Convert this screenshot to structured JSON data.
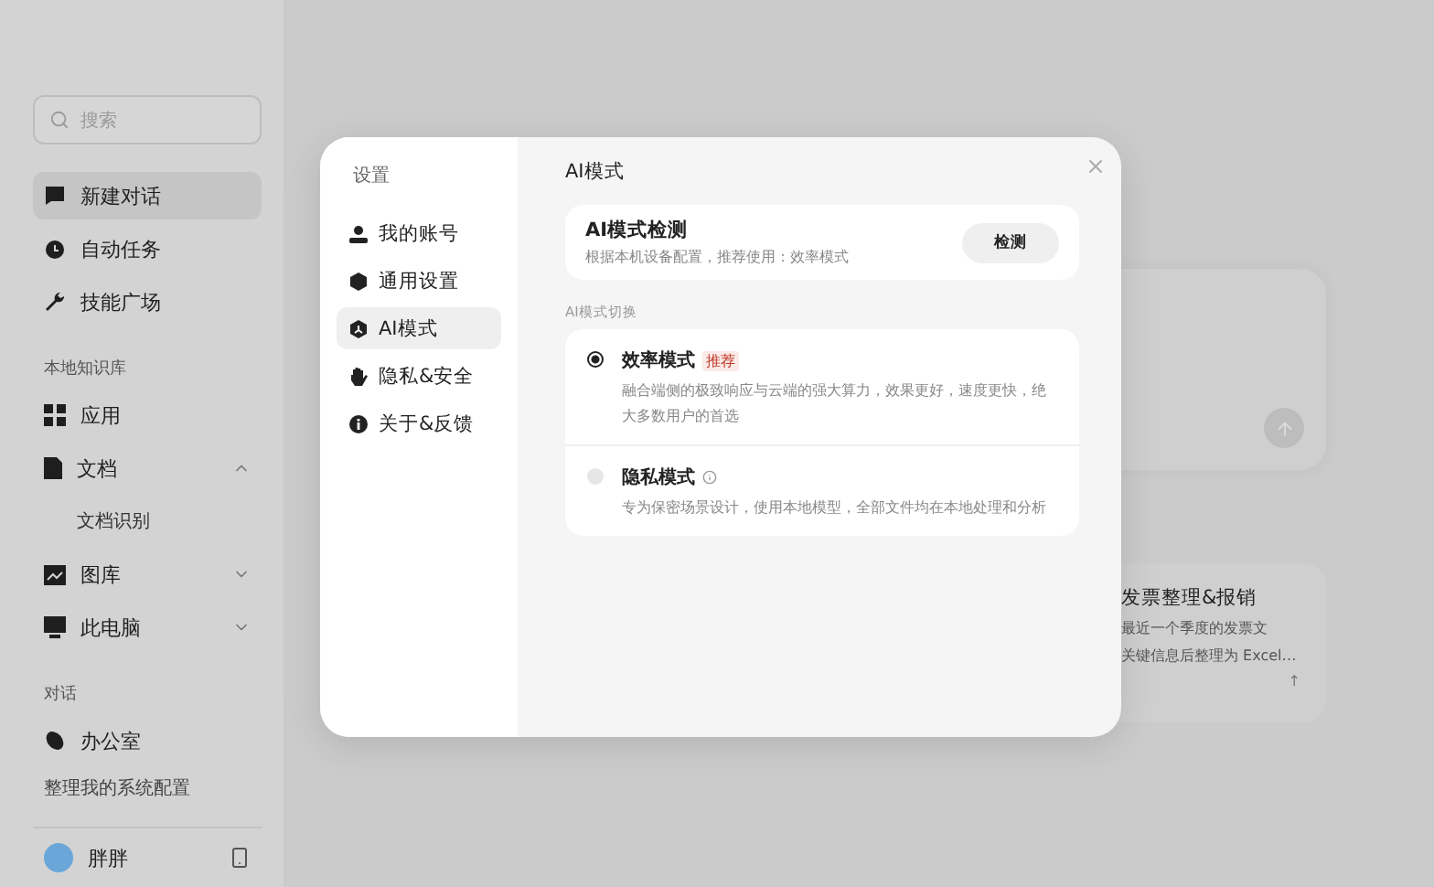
{
  "sidebar": {
    "search": {
      "placeholder": "搜索"
    },
    "items": [
      {
        "kind": "item",
        "label": "新建对话",
        "selected": true
      },
      {
        "kind": "item",
        "label": "自动任务",
        "selected": false
      },
      {
        "kind": "item",
        "label": "技能广场",
        "selected": false
      },
      {
        "kind": "section",
        "label": "本地知识库"
      },
      {
        "kind": "item",
        "label": "应用",
        "selected": false
      },
      {
        "kind": "item",
        "label": "文档",
        "selected": false,
        "expanded": true
      },
      {
        "kind": "sub",
        "label": "文档识别",
        "selected": false
      },
      {
        "kind": "item",
        "label": "图库",
        "selected": false,
        "expanded": false
      },
      {
        "kind": "item",
        "label": "此电脑",
        "selected": false,
        "expanded": false
      },
      {
        "kind": "section",
        "label": "对话"
      },
      {
        "kind": "item",
        "label": "办公室",
        "selected": false
      },
      {
        "kind": "history",
        "label": "整理我的系统配置"
      }
    ],
    "user": {
      "name": "胖胖"
    }
  },
  "background_card": {
    "title": "发票整理&报销",
    "lines": [
      "最近一个季度的发票文",
      "关键信息后整理为 Excel…"
    ],
    "hint": "↑"
  },
  "dialog": {
    "nav_title": "设置",
    "nav": [
      {
        "label": "我的账号",
        "selected": false
      },
      {
        "label": "通用设置",
        "selected": false
      },
      {
        "label": "AI模式",
        "selected": true
      },
      {
        "label": "隐私&安全",
        "selected": false
      },
      {
        "label": "关于&反馈",
        "selected": false
      }
    ],
    "title": "AI模式",
    "detect": {
      "title": "AI模式检测",
      "subtitle": "根据本机设备配置，推荐使用：效率模式",
      "button": "检测"
    },
    "section_label": "AI模式切换",
    "modes": [
      {
        "name": "效率模式",
        "tag": "推荐",
        "info": false,
        "selected": true,
        "description": "融合端侧的极致响应与云端的强大算力，效果更好，速度更快，绝大多数用户的首选"
      },
      {
        "name": "隐私模式",
        "info": true,
        "selected": false,
        "description": "专为保密场景设计，使用本地模型，全部文件均在本地处理和分析"
      }
    ]
  }
}
